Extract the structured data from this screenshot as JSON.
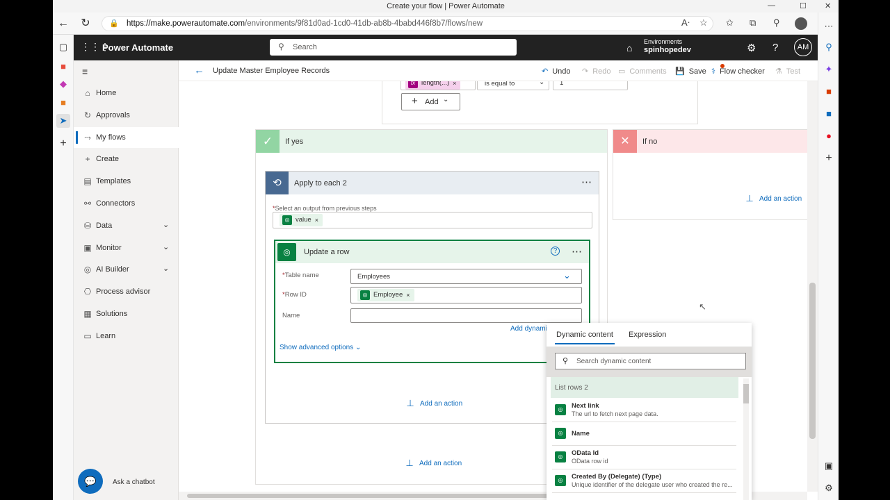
{
  "window": {
    "title": "Create your flow | Power Automate"
  },
  "browser": {
    "url_host": "https://make.powerautomate.com",
    "url_path": "/environments/9f81d0ad-1cd0-41db-ab8b-4babd446f8b7/flows/new"
  },
  "header": {
    "app_name": "Power Automate",
    "search_placeholder": "Search",
    "env_label": "Environments",
    "env_name": "spinhopedev",
    "avatar": "AM"
  },
  "nav": {
    "items": [
      {
        "label": "Home",
        "icon": "home-icon"
      },
      {
        "label": "Approvals",
        "icon": "approvals-icon"
      },
      {
        "label": "My flows",
        "icon": "flow-icon",
        "selected": true
      },
      {
        "label": "Create",
        "icon": "plus-icon"
      },
      {
        "label": "Templates",
        "icon": "templates-icon"
      },
      {
        "label": "Connectors",
        "icon": "connectors-icon"
      },
      {
        "label": "Data",
        "icon": "data-icon"
      },
      {
        "label": "Monitor",
        "icon": "monitor-icon"
      },
      {
        "label": "AI Builder",
        "icon": "ai-builder-icon"
      },
      {
        "label": "Process advisor",
        "icon": "process-advisor-icon"
      },
      {
        "label": "Solutions",
        "icon": "solutions-icon"
      },
      {
        "label": "Learn",
        "icon": "learn-icon"
      }
    ],
    "chatbot": "Ask a chatbot"
  },
  "toolbar": {
    "flow_name": "Update Master Employee Records",
    "undo": "Undo",
    "redo": "Redo",
    "comments": "Comments",
    "save": "Save",
    "flow_checker": "Flow checker",
    "test": "Test"
  },
  "condition": {
    "expr_token": "length(...)",
    "operator": "is equal to",
    "value": "1",
    "add_button": "Add"
  },
  "if_yes": {
    "title": "If yes",
    "apply_each": {
      "title": "Apply to each 2",
      "select_label": "Select an output from previous steps",
      "token": "value",
      "update_row": {
        "title": "Update a row",
        "table_label": "Table name",
        "table_value": "Employees",
        "rowid_label": "Row ID",
        "rowid_token": "Employee",
        "name_label": "Name",
        "add_dynamic": "Add dynamic content",
        "advanced": "Show advanced options"
      },
      "add_action": "Add an action"
    },
    "add_action": "Add an action"
  },
  "if_no": {
    "title": "If no",
    "add_action": "Add an action"
  },
  "dynamic_panel": {
    "tab_dynamic": "Dynamic content",
    "tab_expression": "Expression",
    "search_placeholder": "Search dynamic content",
    "group": "List rows 2",
    "items": [
      {
        "title": "Next link",
        "desc": "The url to fetch next page data."
      },
      {
        "title": "Name",
        "desc": ""
      },
      {
        "title": "OData Id",
        "desc": "OData row id"
      },
      {
        "title": "Created By (Delegate) (Type)",
        "desc": "Unique identifier of the delegate user who created the re..."
      }
    ]
  },
  "colors": {
    "yes_bg": "#e6f4ea",
    "yes_icon": "#92d5a3",
    "no_bg": "#fde7e9",
    "no_icon": "#f08a8a",
    "apply_header": "#e8edf2",
    "apply_icon": "#486991",
    "accent": "#0f6cbd",
    "dataverse": "#088142"
  }
}
